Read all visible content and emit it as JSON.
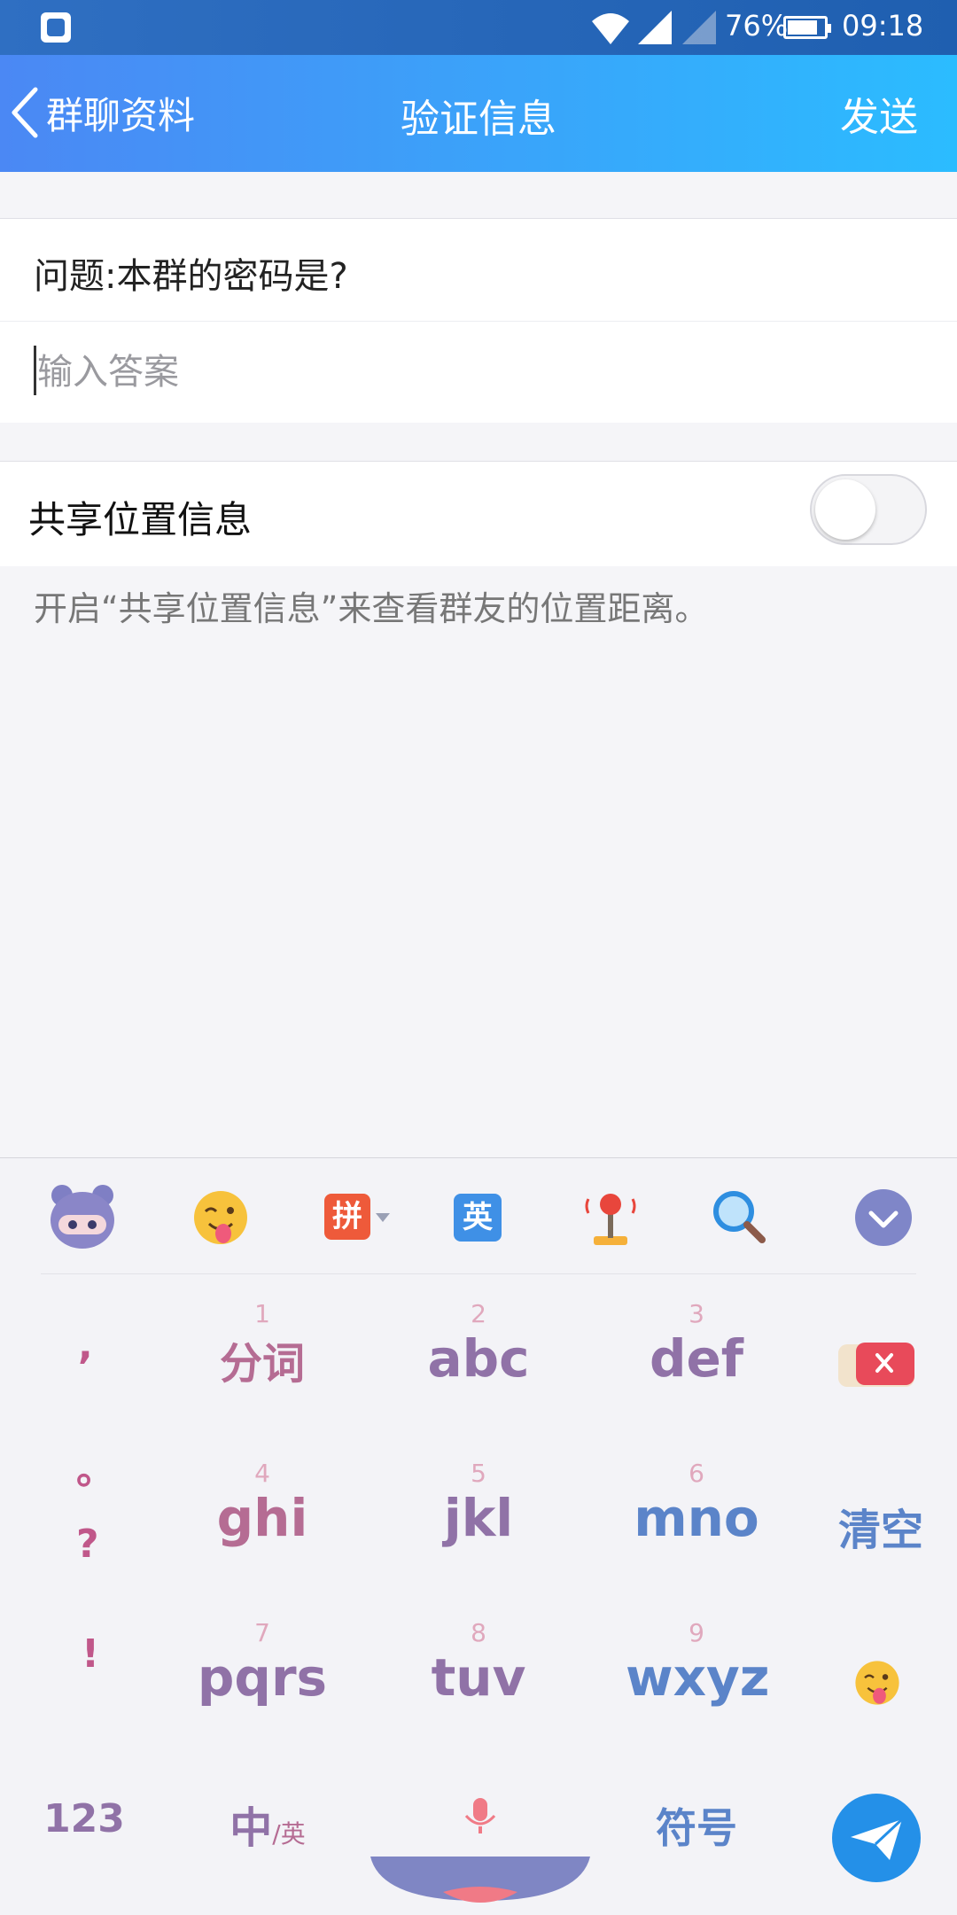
{
  "status_bar": {
    "battery_text": "76%",
    "battery_level": 0.76,
    "time": "09:18",
    "icons": [
      "app-notification-icon",
      "wifi-icon",
      "signal-icon",
      "signal-icon"
    ]
  },
  "title_bar": {
    "back_label": "群聊资料",
    "title": "验证信息",
    "send_label": "发送"
  },
  "form": {
    "question": "问题:本群的密码是?",
    "answer_value": "",
    "answer_placeholder": "输入答案",
    "share_label": "共享位置信息",
    "share_enabled": false,
    "hint": "开启“共享位置信息”来查看群友的位置距离。"
  },
  "keyboard": {
    "toolbar_icons": [
      "mascot-icon",
      "emoji-icon",
      "pinyin-icon",
      "english-icon",
      "joystick-icon",
      "search-icon",
      "collapse-icon"
    ],
    "toolbar": {
      "pinyin": "拼",
      "english": "英"
    },
    "keys": [
      {
        "num": "1",
        "label": "分词"
      },
      {
        "num": "2",
        "label": "abc"
      },
      {
        "num": "3",
        "label": "def"
      },
      {
        "num": "4",
        "label": "ghi"
      },
      {
        "num": "5",
        "label": "jkl"
      },
      {
        "num": "6",
        "label": "mno"
      },
      {
        "num": "7",
        "label": "pqrs"
      },
      {
        "num": "8",
        "label": "tuv"
      },
      {
        "num": "9",
        "label": "wxyz"
      }
    ],
    "punctuation": [
      ",",
      "。",
      "?",
      "!"
    ],
    "clear_label": "清空",
    "num_key": "123",
    "lang_key_main": "中",
    "lang_key_sub": "/英",
    "symbol_key": "符号",
    "colors": {
      "pink": "#b56c93",
      "purple": "#9072a7",
      "blue": "#5b84c9",
      "send": "#2490e8"
    }
  }
}
